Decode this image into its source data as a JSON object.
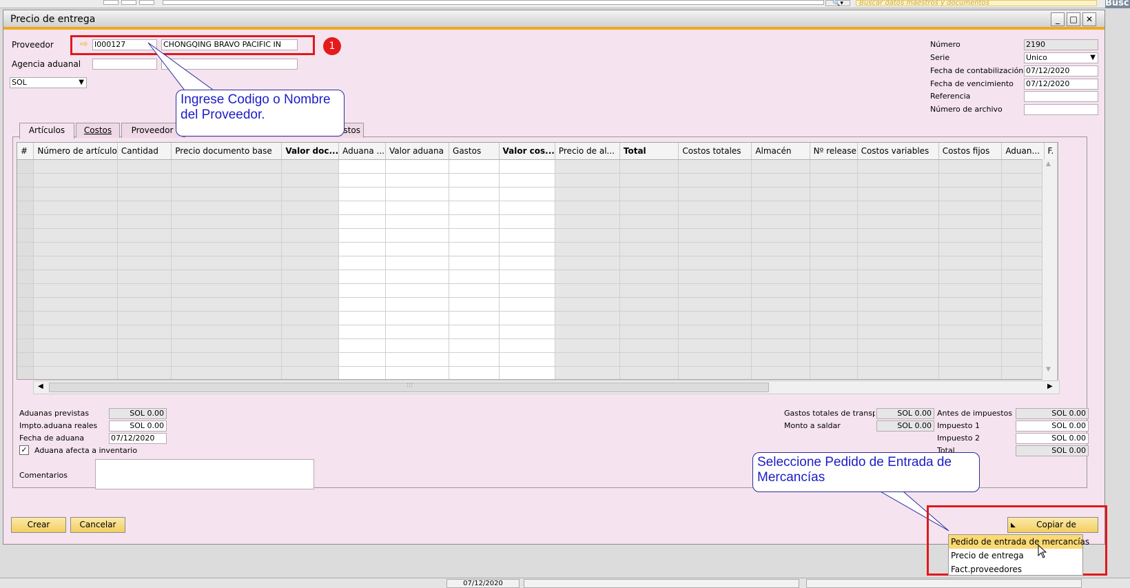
{
  "topbar": {
    "search_placeholder": "Buscar datos maestros y documentos",
    "search_icon": "magnifier-icon",
    "busc": "Busc"
  },
  "window": {
    "title": "Precio de entrega",
    "minimize": "_",
    "maximize": "□",
    "close": "✕"
  },
  "header": {
    "proveedor_label": "Proveedor",
    "proveedor_code": "I000127",
    "proveedor_name": "CHONGQING BRAVO PACIFIC IN",
    "agencia_label": "Agencia aduanal",
    "currency": "SOL",
    "numero_label": "Número",
    "numero_value": "2190",
    "serie_label": "Serie",
    "serie_value": "Unico",
    "fecha_cont_label": "Fecha de contabilización",
    "fecha_cont_value": "07/12/2020",
    "fecha_venc_label": "Fecha de vencimiento",
    "fecha_venc_value": "07/12/2020",
    "referencia_label": "Referencia",
    "archivo_label": "Número de archivo"
  },
  "annotations": {
    "badge": "1",
    "callout1": "Ingrese Codigo o Nombre del Proveedor.",
    "callout2": "Seleccione Pedido de Entrada de Mercancías"
  },
  "tabs": [
    "Artículos",
    "Costos",
    "Proveedor",
    "Gastos"
  ],
  "grid": {
    "columns": [
      "#",
      "Número de artículo",
      "Cantidad",
      "Precio documento base",
      "Valor doc...",
      "Aduana ...",
      "Valor aduana",
      "Gastos",
      "Valor cos...",
      "Precio de al...",
      "Total",
      "Costos totales",
      "Almacén",
      "Nº release",
      "Costos variables",
      "Costos fijos",
      "Aduan...",
      "F."
    ],
    "scroll_grip": ":::"
  },
  "footer": {
    "aduanas_prev_label": "Aduanas previstas",
    "aduanas_prev_value": "SOL 0.00",
    "impto_label": "Impto.aduana reales",
    "impto_value": "SOL 0.00",
    "fecha_aduana_label": "Fecha de aduana",
    "fecha_aduana_value": "07/12/2020",
    "afecta_label": "Aduana afecta a inventario",
    "afecta_mark": "✓",
    "comentarios_label": "Comentarios",
    "gastos_transp_label": "Gastos totales de transp",
    "gastos_transp_value": "SOL 0.00",
    "monto_label": "Monto a saldar",
    "monto_value": "SOL 0.00",
    "antes_label": "Antes de impuestos",
    "antes_value": "SOL 0.00",
    "imp1_label": "Impuesto 1",
    "imp1_value": "SOL 0.00",
    "imp2_label": "Impuesto 2",
    "imp2_value": "SOL 0.00",
    "total_label": "Total",
    "total_value": "SOL 0.00"
  },
  "buttons": {
    "crear": "Crear",
    "cancelar": "Cancelar",
    "copiar": "Copiar de"
  },
  "copy_menu": [
    "Pedido de entrada de mercancías",
    "Precio de entrega",
    "Fact.proveedores"
  ],
  "statusbar": {
    "date": "07/12/2020"
  }
}
